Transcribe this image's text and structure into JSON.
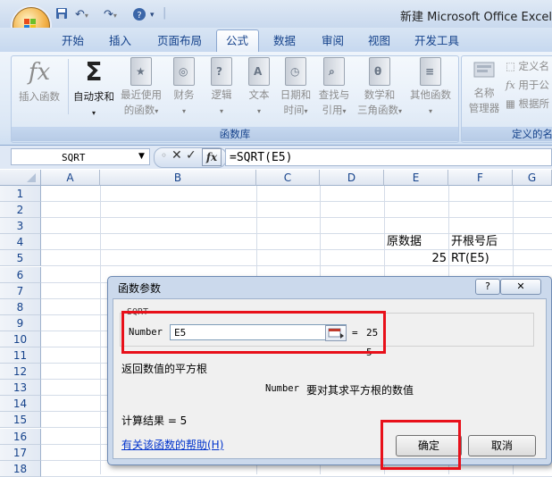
{
  "window": {
    "title": "新建 Microsoft Office Excel"
  },
  "tabs": [
    "开始",
    "插入",
    "页面布局",
    "公式",
    "数据",
    "审阅",
    "视图",
    "开发工具"
  ],
  "active_tab": "公式",
  "ribbon": {
    "insert_function": {
      "icon": "fx",
      "label": "插入函数"
    },
    "autosum": {
      "icon": "Σ",
      "label": "自动求和"
    },
    "recent": {
      "line1": "最近使用",
      "line2": "的函数"
    },
    "finance": {
      "label": "财务"
    },
    "logic": {
      "label": "逻辑"
    },
    "text": {
      "label": "文本"
    },
    "datetime": {
      "line1": "日期和",
      "line2": "时间"
    },
    "lookup": {
      "line1": "查找与",
      "line2": "引用"
    },
    "math": {
      "line1": "数学和",
      "line2": "三角函数"
    },
    "other": {
      "label": "其他函数"
    },
    "group_label": "函数库",
    "name_manager": {
      "line1": "名称",
      "line2": "管理器"
    },
    "define_name": "定义名",
    "use_in_formula": "用于公",
    "create_from_selection": "根据所",
    "defined_names_group": "定义的名"
  },
  "formula_bar": {
    "name_box": "SQRT",
    "fx_label": "fx",
    "formula": "=SQRT(E5)"
  },
  "grid": {
    "columns": [
      "A",
      "B",
      "C",
      "D",
      "E",
      "F",
      "G"
    ],
    "rows": [
      "1",
      "2",
      "3",
      "4",
      "5",
      "6",
      "7",
      "8",
      "9",
      "10",
      "11",
      "12",
      "13",
      "14",
      "15",
      "16",
      "17",
      "18"
    ],
    "cells": {
      "E4": "原数据",
      "F4": "开根号后",
      "E5": "25",
      "F5": "RT(E5)"
    }
  },
  "dialog": {
    "title": "函数参数",
    "help_btn": "?",
    "close_btn": "✕",
    "function_name": "SQRT",
    "arg_label": "Number",
    "arg_value": "E5",
    "arg_equals": "=",
    "arg_result": "25",
    "stray": "5",
    "description": "返回数值的平方根",
    "arg_desc_name": "Number",
    "arg_desc_text": "要对其求平方根的数值",
    "calc_result": "计算结果 = 5",
    "help_link": "有关该函数的帮助(H)",
    "ok_label": "确定",
    "cancel_label": "取消"
  }
}
